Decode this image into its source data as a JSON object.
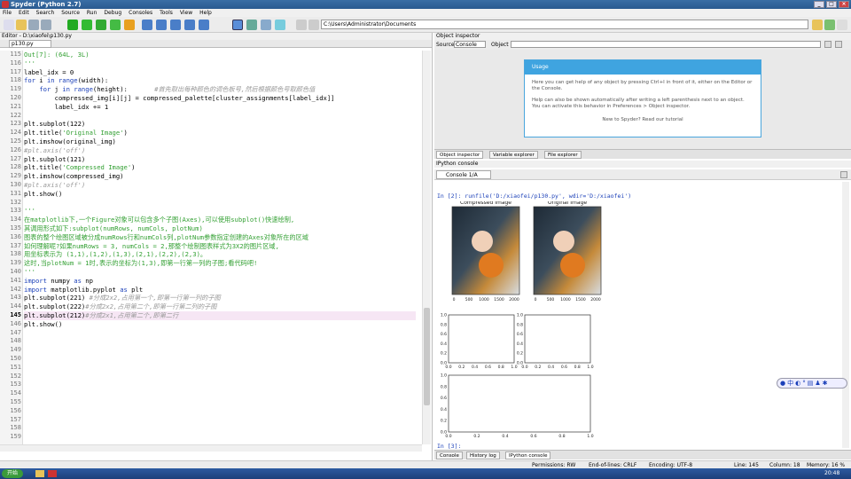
{
  "window": {
    "title": "Spyder (Python 2.7)"
  },
  "menu": [
    "File",
    "Edit",
    "Search",
    "Source",
    "Run",
    "Debug",
    "Consoles",
    "Tools",
    "View",
    "Help"
  ],
  "toolbar": {
    "path": "C:\\Users\\Administrator\\Documents"
  },
  "editor": {
    "header": "Editor - D:\\xiaofei\\p130.py",
    "tab": "p130.py",
    "lines": [
      {
        "n": "115",
        "t": "Out[7]: (64L, 3L)",
        "c": "g"
      },
      {
        "n": "116",
        "t": "'''",
        "c": "g"
      },
      {
        "n": "117",
        "t": "label_idx = 0",
        "c": ""
      },
      {
        "n": "118",
        "t": "for i in range(width):",
        "c": ""
      },
      {
        "n": "119",
        "t": "    for j in range(height):       #首先取出每种颜色的调色板号,然后根据颜色号取颜色值",
        "c": ""
      },
      {
        "n": "120",
        "t": "        compressed_img[i][j] = compressed_palette[cluster_assignments[label_idx]]",
        "c": ""
      },
      {
        "n": "121",
        "t": "        label_idx += 1",
        "c": ""
      },
      {
        "n": "122",
        "t": "",
        "c": ""
      },
      {
        "n": "123",
        "t": "plt.subplot(122)",
        "c": ""
      },
      {
        "n": "124",
        "t": "plt.title('Original Image')",
        "c": ""
      },
      {
        "n": "125",
        "t": "plt.imshow(original_img)",
        "c": ""
      },
      {
        "n": "126",
        "t": "#plt.axis('off')",
        "c": "gr"
      },
      {
        "n": "127",
        "t": "plt.subplot(121)",
        "c": ""
      },
      {
        "n": "128",
        "t": "plt.title('Compressed Image')",
        "c": ""
      },
      {
        "n": "129",
        "t": "plt.imshow(compressed_img)",
        "c": ""
      },
      {
        "n": "130",
        "t": "#plt.axis('off')",
        "c": "gr"
      },
      {
        "n": "131",
        "t": "plt.show()",
        "c": ""
      },
      {
        "n": "132",
        "t": "",
        "c": ""
      },
      {
        "n": "133",
        "t": "'''",
        "c": "g"
      },
      {
        "n": "134",
        "t": "在matplotlib下,一个Figure对象可以包含多个子图(Axes),可以使用subplot()快速绘制,",
        "c": "g"
      },
      {
        "n": "135",
        "t": "其调用形式如下:subplot(numRows, numCols, plotNum)",
        "c": "g"
      },
      {
        "n": "136",
        "t": "图表的整个绘图区域被分成numRows行和numCols列,plotNum参数指定创建的Axes对象所在的区域",
        "c": "g"
      },
      {
        "n": "137",
        "t": "如何理解呢?如果numRows = 3, numCols = 2,那整个绘制图表样式为3X2的图片区域,",
        "c": "g"
      },
      {
        "n": "138",
        "t": "用坐标表示为 (1,1),(1,2),(1,3),(2,1),(2,2),(2,3)。",
        "c": "g"
      },
      {
        "n": "139",
        "t": "这时,当plotNum = 1时,表示的坐标为(1,3),即第一行第一列的子图;看代码吧!",
        "c": "g"
      },
      {
        "n": "140",
        "t": "'''",
        "c": "g"
      },
      {
        "n": "141",
        "t": "import numpy as np",
        "c": ""
      },
      {
        "n": "142",
        "t": "import matplotlib.pyplot as plt",
        "c": ""
      },
      {
        "n": "143",
        "t": "plt.subplot(221) #分成2x2,占用第一个,即第一行第一列的子图",
        "c": ""
      },
      {
        "n": "144",
        "t": "plt.subplot(222)#分成2x2,占用第二个,即第一行第二列的子图",
        "c": ""
      },
      {
        "n": "145",
        "t": "plt.subplot(212)#分成2x1,占用第二个,即第二行",
        "c": ""
      },
      {
        "n": "146",
        "t": "plt.show()",
        "c": ""
      },
      {
        "n": "147",
        "t": "",
        "c": ""
      },
      {
        "n": "148",
        "t": "",
        "c": ""
      },
      {
        "n": "149",
        "t": "",
        "c": ""
      },
      {
        "n": "150",
        "t": "",
        "c": ""
      },
      {
        "n": "151",
        "t": "",
        "c": ""
      },
      {
        "n": "152",
        "t": "",
        "c": ""
      },
      {
        "n": "153",
        "t": "",
        "c": ""
      },
      {
        "n": "154",
        "t": "",
        "c": ""
      },
      {
        "n": "155",
        "t": "",
        "c": ""
      },
      {
        "n": "156",
        "t": "",
        "c": ""
      },
      {
        "n": "157",
        "t": "",
        "c": ""
      },
      {
        "n": "158",
        "t": "",
        "c": ""
      },
      {
        "n": "159",
        "t": "",
        "c": ""
      }
    ]
  },
  "object_inspector": {
    "header": "Object inspector",
    "source_label": "Source",
    "source_value": "Console",
    "object_label": "Object",
    "help_title": "Usage",
    "help_p1": "Here you can get help of any object by pressing Ctrl+I in front of it, either on the Editor or the Console.",
    "help_p2": "Help can also be shown automatically after writing a left parenthesis next to an object. You can activate this behavior in Preferences > Object inspector.",
    "help_p3": "New to Spyder? Read our tutorial"
  },
  "tabs_mid": [
    "Object inspector",
    "Variable explorer",
    "File explorer"
  ],
  "console": {
    "header": "IPython console",
    "tab": "Console 1/A",
    "input": "In [2]: runfile('D:/xiaofei/p130.py', wdir='D:/xiaofei')",
    "titles": [
      "Compressed Image",
      "Original Image"
    ],
    "xticks_img": [
      "0",
      "500",
      "1000",
      "1500",
      "2000"
    ],
    "subplot_ticks": [
      "0.0",
      "0.2",
      "0.4",
      "0.6",
      "0.8",
      "1.0"
    ],
    "prompt": "In [3]:"
  },
  "tabs_bottom": [
    "Console",
    "History log",
    "IPython console"
  ],
  "status": {
    "permissions": "Permissions: RW",
    "eol": "End-of-lines: CRLF",
    "encoding": "Encoding: UTF-8",
    "line": "Line: 145",
    "column": "Column: 18",
    "memory": "Memory: 16 %"
  },
  "taskbar": {
    "start": "开始",
    "clock": "20:48"
  }
}
